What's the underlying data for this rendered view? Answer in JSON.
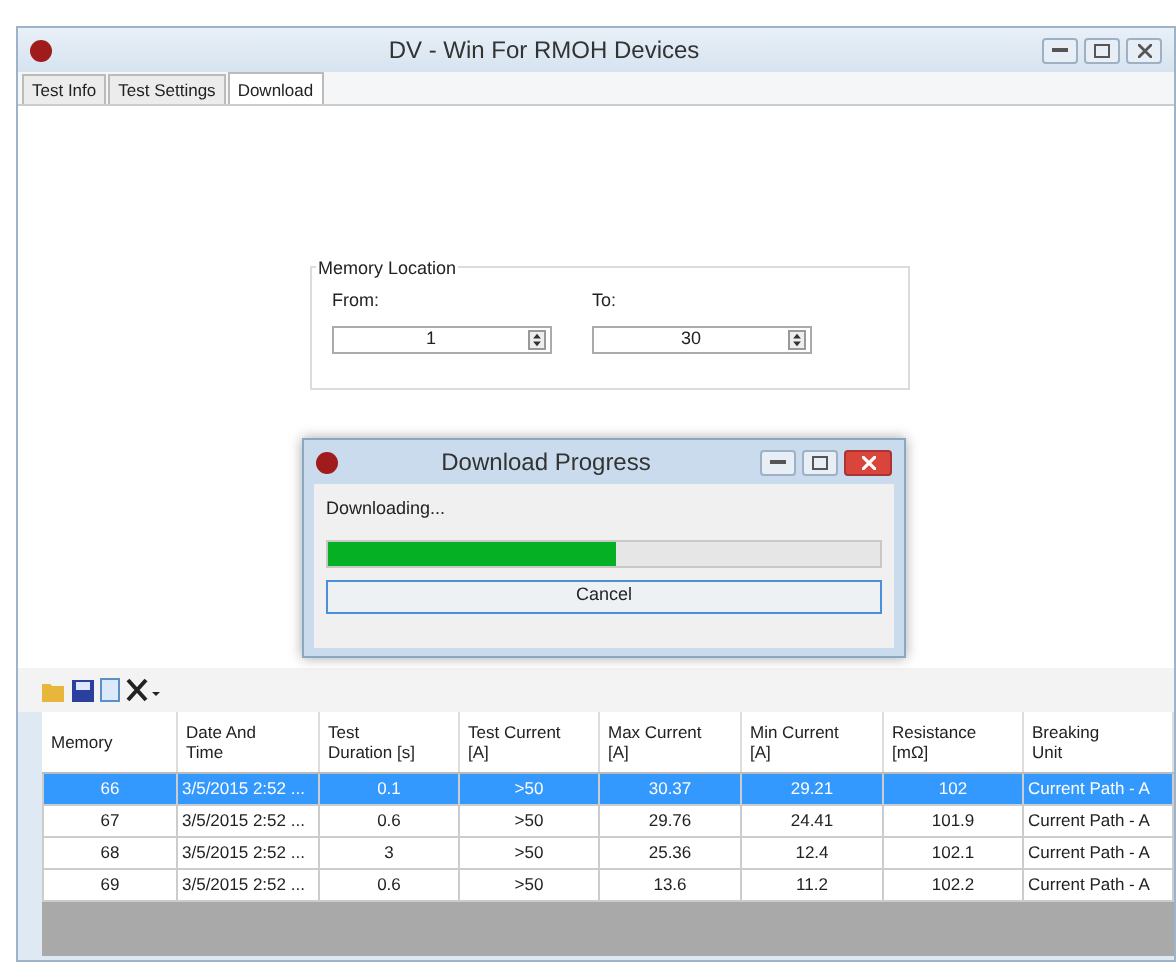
{
  "window": {
    "title": "DV - Win For RMOH Devices"
  },
  "tabs": [
    {
      "label": "Test Info",
      "selected": false
    },
    {
      "label": "Test Settings",
      "selected": false
    },
    {
      "label": "Download",
      "selected": true
    }
  ],
  "memory_location": {
    "title": "Memory Location",
    "from_label": "From:",
    "from_value": "1",
    "to_label": "To:",
    "to_value": "30"
  },
  "dialog": {
    "title": "Download Progress",
    "status": "Downloading...",
    "level": 0.52,
    "cancel": "Cancel"
  },
  "table": {
    "columns": [
      "Memory",
      "Date And\nTime",
      "Test\nDuration [s]",
      "Test Current\n[A]",
      "Max Current\n[A]",
      "Min Current\n[A]",
      "Resistance\n[mΩ]",
      "Breaking\nUnit"
    ],
    "rows": [
      {
        "selected": true,
        "cells": [
          "66",
          "3/5/2015 2:52 ...",
          "0.1",
          ">50",
          "30.37",
          "29.21",
          "102",
          "Current Path - A"
        ]
      },
      {
        "selected": false,
        "cells": [
          "67",
          "3/5/2015 2:52 ...",
          "0.6",
          ">50",
          "29.76",
          "24.41",
          "101.9",
          "Current Path - A"
        ]
      },
      {
        "selected": false,
        "cells": [
          "68",
          "3/5/2015 2:52 ...",
          "3",
          ">50",
          "25.36",
          "12.4",
          "102.1",
          "Current Path - A"
        ]
      },
      {
        "selected": false,
        "cells": [
          "69",
          "3/5/2015 2:52 ...",
          "0.6",
          ">50",
          "13.6",
          "11.2",
          "102.2",
          "Current Path - A"
        ]
      }
    ]
  }
}
